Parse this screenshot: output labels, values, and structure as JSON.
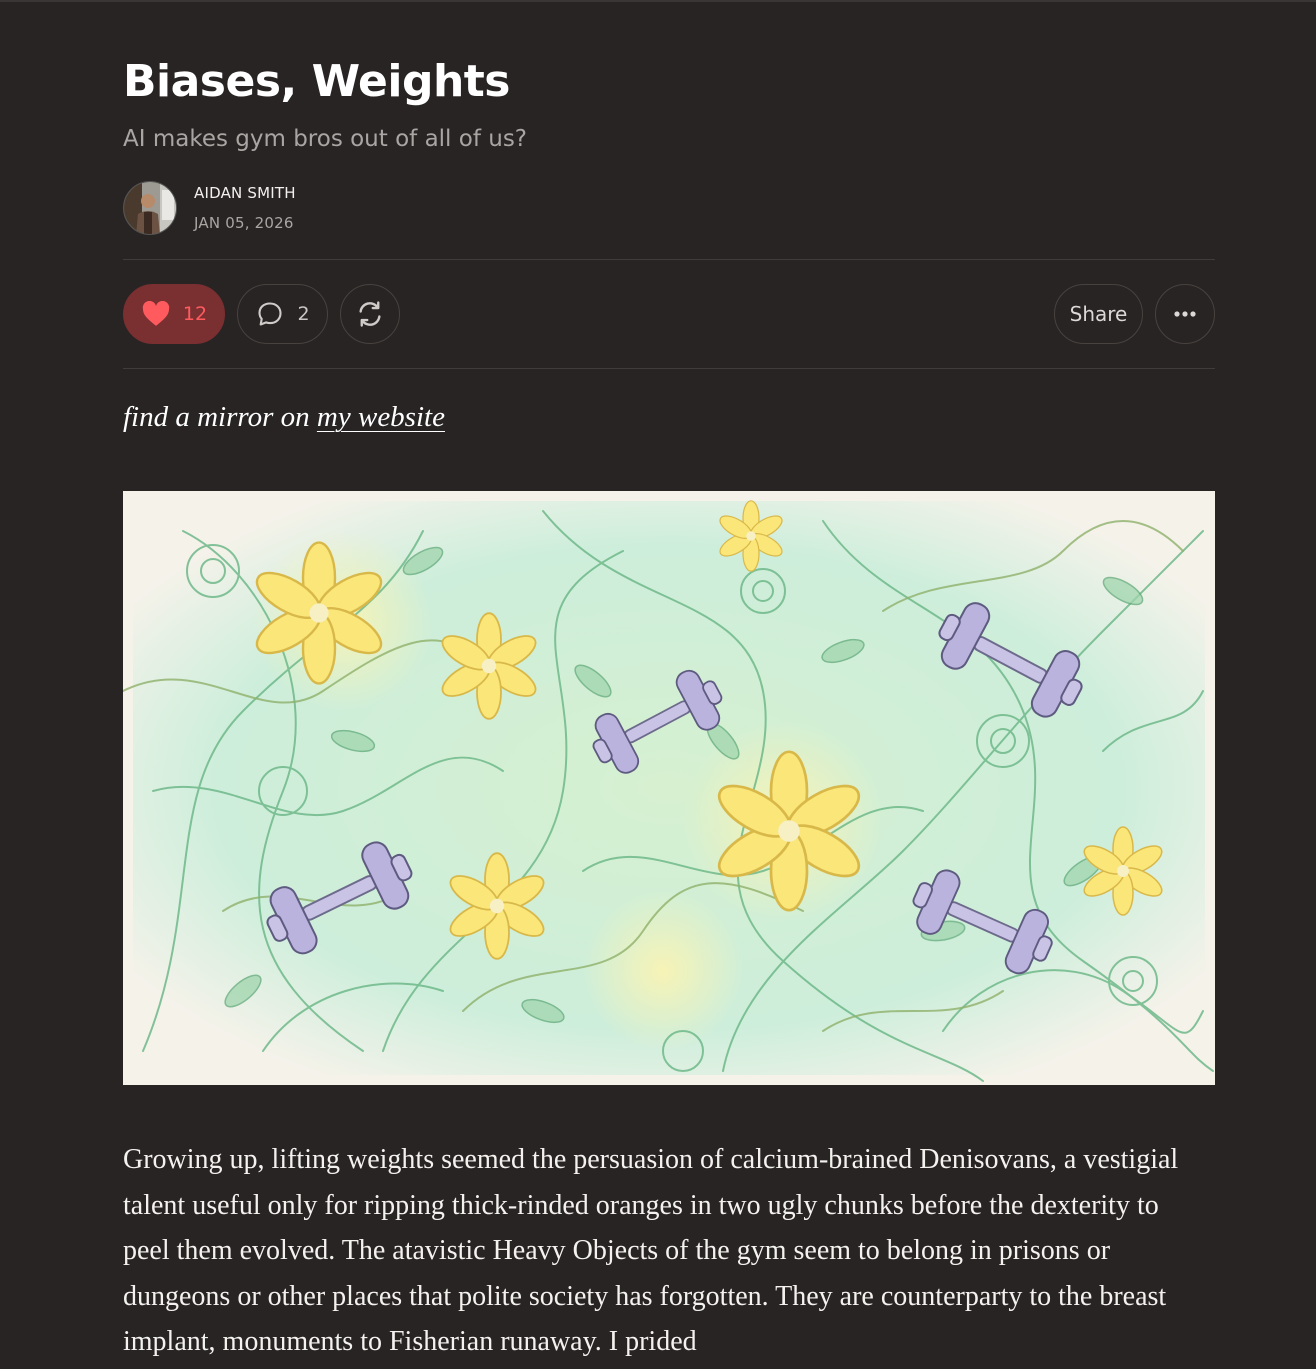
{
  "post": {
    "title": "Biases, Weights",
    "subtitle": "AI makes gym bros out of all of us?",
    "author": "AIDAN SMITH",
    "date": "JAN 05, 2026"
  },
  "actions": {
    "like_count": "12",
    "comment_count": "2",
    "share_label": "Share",
    "like_color": "#ff5b5f",
    "like_background": "#7a2f31"
  },
  "mirror_line": {
    "prefix": "find a mirror on ",
    "link_text": "my website"
  },
  "hero_image": {
    "alt": "Pencil drawing of vines, yellow flowers and dumbbells"
  },
  "body": {
    "paragraph_1": "Growing up, lifting weights seemed the persuasion of calcium-brained Denisovans, a vestigial talent useful only for ripping thick-rinded oranges in two ugly chunks before the dexterity to peel them evolved. The atavistic Heavy Objects of the gym seem to belong in prisons or dungeons or other places that polite society has forgotten. They are counterparty to the breast implant, monuments to Fisherian runaway. I prided"
  },
  "colors": {
    "background": "#282424",
    "divider": "#403c3b",
    "muted_text": "#a9a5a3"
  }
}
